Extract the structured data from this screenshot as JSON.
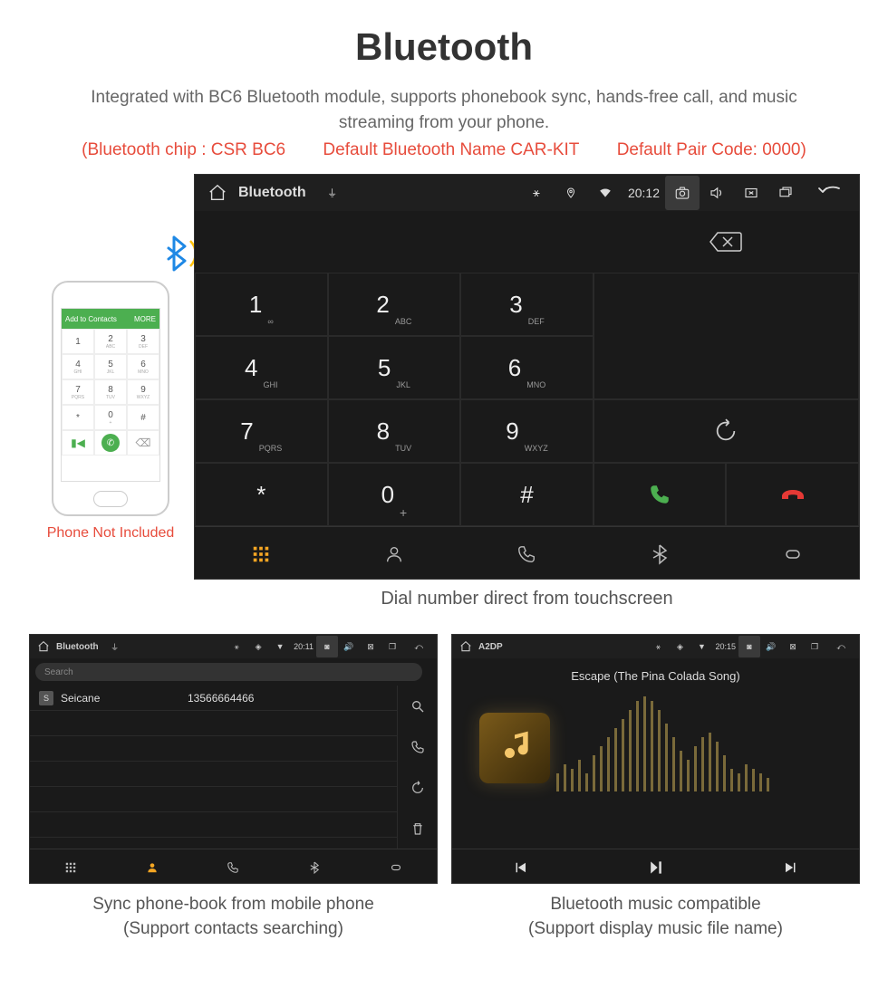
{
  "title": "Bluetooth",
  "subtitle": "Integrated with BC6 Bluetooth module, supports phonebook sync, hands-free call, and music streaming from your phone.",
  "spec": {
    "chip": "(Bluetooth chip : CSR BC6",
    "name": "Default Bluetooth Name CAR-KIT",
    "code": "Default Pair Code: 0000)"
  },
  "phone": {
    "top_left": "Add to Contacts",
    "top_right": "MORE",
    "keys": [
      "1",
      "2",
      "3",
      "4",
      "5",
      "6",
      "7",
      "8",
      "9",
      "*",
      "0",
      "#"
    ],
    "letters": [
      "",
      "ABC",
      "DEF",
      "GHI",
      "JKL",
      "MNO",
      "PQRS",
      "TUV",
      "WXYZ",
      "",
      "+",
      ""
    ],
    "caption": "Phone Not Included"
  },
  "dialer": {
    "status": {
      "title": "Bluetooth",
      "time": "20:12"
    },
    "keys": [
      {
        "d": "1",
        "l": "∞"
      },
      {
        "d": "2",
        "l": "ABC"
      },
      {
        "d": "3",
        "l": "DEF"
      },
      {
        "d": "4",
        "l": "GHI"
      },
      {
        "d": "5",
        "l": "JKL"
      },
      {
        "d": "6",
        "l": "MNO"
      },
      {
        "d": "7",
        "l": "PQRS"
      },
      {
        "d": "8",
        "l": "TUV"
      },
      {
        "d": "9",
        "l": "WXYZ"
      },
      {
        "d": "*",
        "l": ""
      },
      {
        "d": "0",
        "l": "+"
      },
      {
        "d": "#",
        "l": ""
      }
    ],
    "caption": "Dial number direct from touchscreen"
  },
  "contacts": {
    "status": {
      "title": "Bluetooth",
      "time": "20:11"
    },
    "search_placeholder": "Search",
    "rows": [
      {
        "badge": "S",
        "name": "Seicane",
        "number": "13566664466"
      }
    ],
    "caption_line1": "Sync phone-book from mobile phone",
    "caption_line2": "(Support contacts searching)"
  },
  "music": {
    "status": {
      "title": "A2DP",
      "time": "20:15"
    },
    "song": "Escape (The Pina Colada Song)",
    "caption_line1": "Bluetooth music compatible",
    "caption_line2": "(Support display music file name)"
  }
}
